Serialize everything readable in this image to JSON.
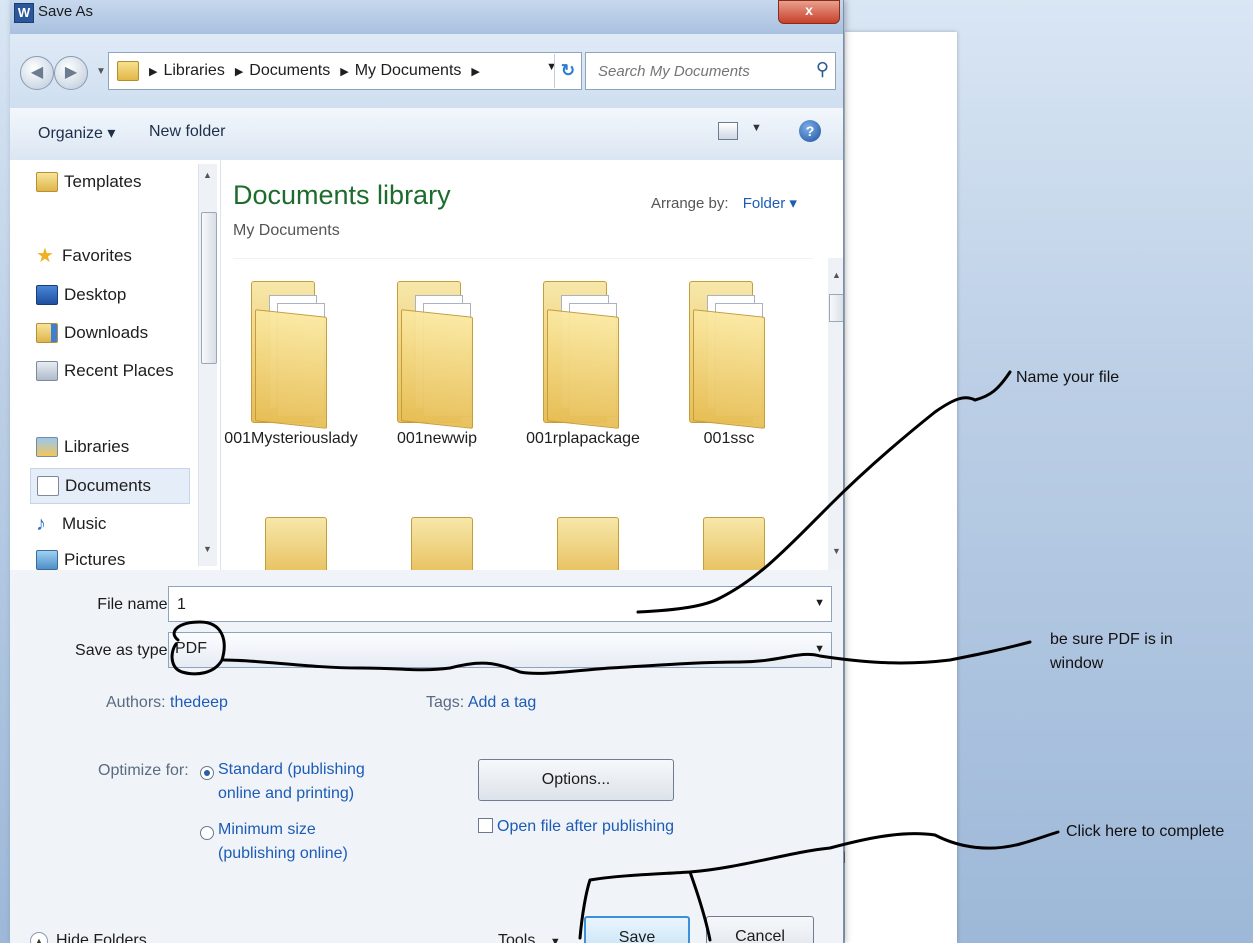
{
  "window": {
    "title": "Save As",
    "app_icon": "W",
    "close": "x"
  },
  "nav": {
    "breadcrumbs": [
      "Libraries",
      "Documents",
      "My Documents"
    ],
    "search_placeholder": "Search My Documents"
  },
  "commandbar": {
    "organize": "Organize ▾",
    "new_folder": "New folder",
    "help": "?"
  },
  "sidebar": {
    "items": [
      {
        "label": "Templates",
        "icon": "folder-icon"
      },
      {
        "label": "Favorites",
        "icon": "star-icon"
      },
      {
        "label": "Desktop",
        "icon": "desktop-icon"
      },
      {
        "label": "Downloads",
        "icon": "downloads-icon"
      },
      {
        "label": "Recent Places",
        "icon": "recent-places-icon"
      },
      {
        "label": "Libraries",
        "icon": "libraries-icon"
      },
      {
        "label": "Documents",
        "icon": "document-icon",
        "selected": true
      },
      {
        "label": "Music",
        "icon": "music-icon"
      },
      {
        "label": "Pictures",
        "icon": "pictures-icon"
      }
    ]
  },
  "content": {
    "title": "Documents library",
    "subtitle": "My Documents",
    "arrange_label": "Arrange by:",
    "arrange_value": "Folder ▾",
    "folders": [
      "001Mysteriouslady",
      "001newwip",
      "001rplapackage",
      "001ssc"
    ]
  },
  "form": {
    "file_name_label": "File name:",
    "file_name_value": "1",
    "save_type_label": "Save as type:",
    "save_type_value": "PDF",
    "authors_label": "Authors:",
    "authors_value": "thedeep",
    "tags_label": "Tags:",
    "tags_value": "Add a tag",
    "optimize_label": "Optimize for:",
    "optimize_standard": "Standard (publishing online and printing)",
    "optimize_minimum": "Minimum size (publishing online)",
    "options_button": "Options...",
    "open_after": "Open file after publishing",
    "hide_folders": "Hide Folders",
    "tools": "Tools",
    "save": "Save",
    "cancel": "Cancel"
  },
  "annotations": {
    "name_file": "Name your file",
    "pdf_note": "be sure PDF is in window",
    "complete": "Click here to complete"
  },
  "colors": {
    "accent_link": "#1d5bb5",
    "library_title": "#1d6b2d",
    "ink": "#000000"
  }
}
